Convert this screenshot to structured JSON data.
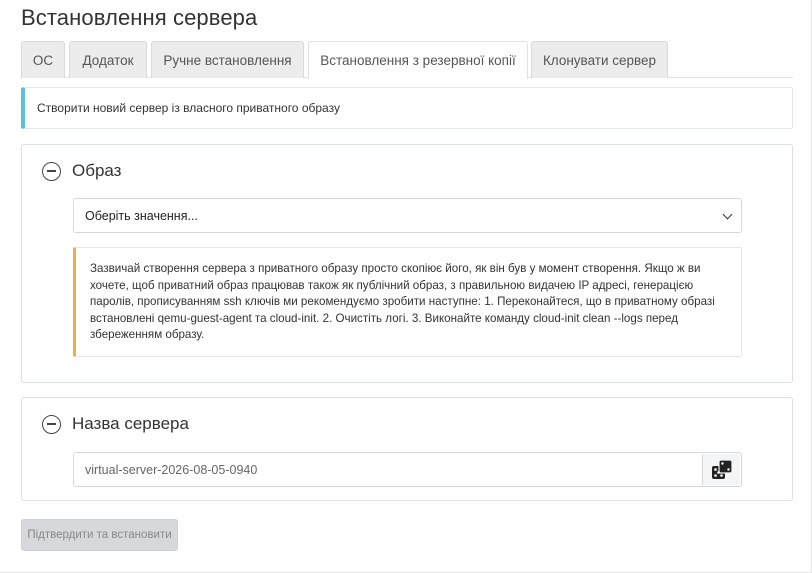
{
  "page": {
    "title": "Встановлення сервера"
  },
  "tabs": [
    {
      "label": "ОС",
      "active": false
    },
    {
      "label": "Додаток",
      "active": false
    },
    {
      "label": "Ручне встановлення",
      "active": false
    },
    {
      "label": "Встановлення з резервної копії",
      "active": true
    },
    {
      "label": "Клонувати сервер",
      "active": false
    }
  ],
  "info": {
    "text": "Створити новий сервер із власного приватного образу"
  },
  "image_section": {
    "title": "Образ",
    "select_value": "Оберіть значення...",
    "warning": "Зазвичай створення сервера з приватного образу просто скопіює його, як він був у момент створення. Якщо ж ви хочете, щоб приватний образ працював також як публічний образ, з правильною видачею IP адресі, генерацією паролів, прописуванням ssh ключів ми рекомендуємо зробити наступне: 1. Переконайтеся, що в приватному образі встановлені qemu-guest-agent та cloud-init. 2. Очистіть логі. 3. Виконайте команду cloud-init clean --logs перед збереженням образу."
  },
  "name_section": {
    "title": "Назва сервера",
    "value": "virtual-server-2026-08-05-0940"
  },
  "actions": {
    "submit_label": "Підтвердити та встановити"
  },
  "colors": {
    "info_accent": "#5bc0de",
    "warning_accent": "#f0ad4e",
    "disabled_button": "#d6d8db"
  }
}
